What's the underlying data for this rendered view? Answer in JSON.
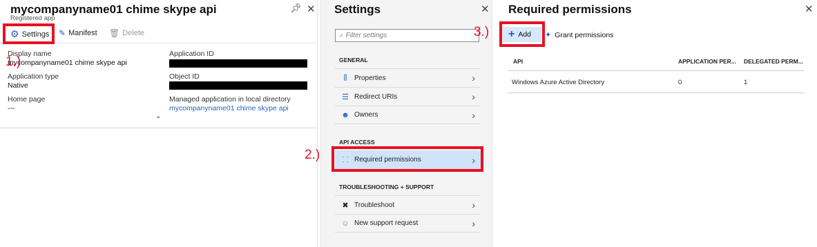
{
  "app_blade": {
    "title": "mycompanyname01 chime skype api",
    "subtitle": "Registered app",
    "pin_icon": "pin-icon",
    "close_icon": "close-icon",
    "toolbar": {
      "settings_label": "Settings",
      "manifest_label": "Manifest",
      "delete_label": "Delete"
    },
    "fields": {
      "display_name_label": "Display name",
      "display_name_value": "mycompanyname01 chime skype api",
      "application_id_label": "Application ID",
      "application_type_label": "Application type",
      "application_type_value": "Native",
      "object_id_label": "Object ID",
      "home_page_label": "Home page",
      "home_page_value": "---",
      "managed_app_label": "Managed application in local directory",
      "managed_app_link": "mycompanyname01 chime skype api"
    }
  },
  "settings_blade": {
    "title": "Settings",
    "search_placeholder": "Filter settings",
    "groups": [
      {
        "heading": "GENERAL",
        "items": [
          "Properties",
          "Redirect URIs",
          "Owners"
        ]
      },
      {
        "heading": "API ACCESS",
        "items": [
          "Required permissions"
        ]
      },
      {
        "heading": "TROUBLESHOOTING + SUPPORT",
        "items": [
          "Troubleshoot",
          "New support request"
        ]
      }
    ]
  },
  "permissions_blade": {
    "title": "Required permissions",
    "add_label": "Add",
    "grant_label": "Grant permissions",
    "columns": [
      "API",
      "APPLICATION PER...",
      "DELEGATED PERM..."
    ],
    "rows": [
      {
        "api": "Windows Azure Active Directory",
        "application": "0",
        "delegated": "1"
      }
    ]
  },
  "annotations": {
    "step1": "1.)",
    "step2": "2.)",
    "step3": "3.)",
    "highlight_color": "#e81123"
  }
}
